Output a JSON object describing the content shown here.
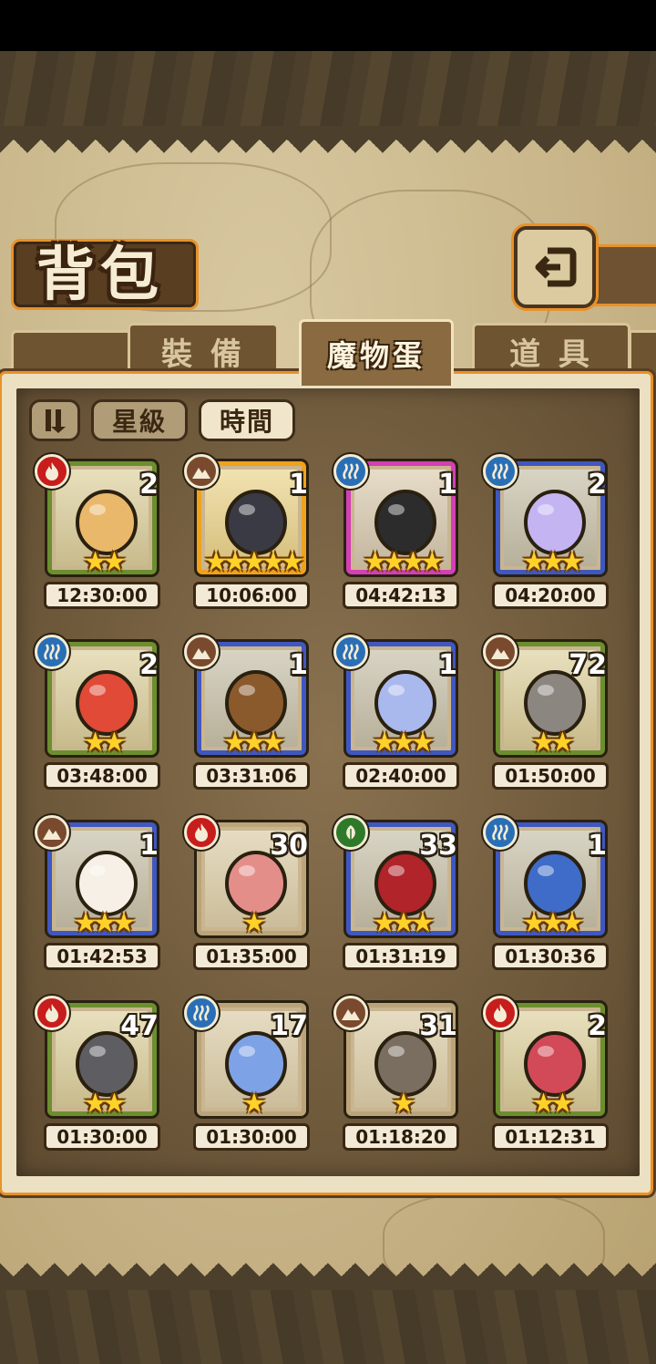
{
  "title": "背包",
  "tabs": [
    {
      "label": "裝 備",
      "active": false
    },
    {
      "label": "魔物蛋",
      "active": true
    },
    {
      "label": "道 具",
      "active": false
    }
  ],
  "sort_buttons": [
    {
      "label": "星級",
      "active": false
    },
    {
      "label": "時間",
      "active": true
    }
  ],
  "colors": {
    "fire": "#c81d1d",
    "earth": "#7a4a2e",
    "water": "#2a6fb6",
    "wood": "#2e7a2a",
    "accent_orange": "#e8922a"
  },
  "eggs": [
    {
      "element": "fire",
      "rarity": "green",
      "count": "2",
      "stars": 2,
      "time": "12:30:00",
      "color": "#e9b86a"
    },
    {
      "element": "earth",
      "rarity": "gold",
      "count": "1",
      "stars": 5,
      "time": "10:06:00",
      "color": "#3a3a44"
    },
    {
      "element": "water",
      "rarity": "purple",
      "count": "1",
      "stars": 4,
      "time": "04:42:13",
      "color": "#2c2c2c"
    },
    {
      "element": "water",
      "rarity": "blue",
      "count": "2",
      "stars": 3,
      "time": "04:20:00",
      "color": "#c4b4f2"
    },
    {
      "element": "water",
      "rarity": "green",
      "count": "2",
      "stars": 2,
      "time": "03:48:00",
      "color": "#e04a36"
    },
    {
      "element": "earth",
      "rarity": "blue",
      "count": "1",
      "stars": 3,
      "time": "03:31:06",
      "color": "#8a5a2c"
    },
    {
      "element": "water",
      "rarity": "blue",
      "count": "1",
      "stars": 3,
      "time": "02:40:00",
      "color": "#a9b9ee"
    },
    {
      "element": "earth",
      "rarity": "green",
      "count": "72",
      "stars": 2,
      "time": "01:50:00",
      "color": "#8c8680"
    },
    {
      "element": "earth",
      "rarity": "blue",
      "count": "1",
      "stars": 3,
      "time": "01:42:53",
      "color": "#f6f0e6"
    },
    {
      "element": "fire",
      "rarity": "plain",
      "count": "30",
      "stars": 1,
      "time": "01:35:00",
      "color": "#e48e8a"
    },
    {
      "element": "wood",
      "rarity": "blue",
      "count": "33",
      "stars": 3,
      "time": "01:31:19",
      "color": "#b0242a"
    },
    {
      "element": "water",
      "rarity": "blue",
      "count": "1",
      "stars": 3,
      "time": "01:30:36",
      "color": "#3e6cc8"
    },
    {
      "element": "fire",
      "rarity": "green",
      "count": "47",
      "stars": 2,
      "time": "01:30:00",
      "color": "#5e5e62"
    },
    {
      "element": "water",
      "rarity": "plain",
      "count": "17",
      "stars": 1,
      "time": "01:30:00",
      "color": "#7ea2e6"
    },
    {
      "element": "earth",
      "rarity": "plain",
      "count": "31",
      "stars": 1,
      "time": "01:18:20",
      "color": "#7a6e60"
    },
    {
      "element": "fire",
      "rarity": "green",
      "count": "2",
      "stars": 2,
      "time": "01:12:31",
      "color": "#d24a58"
    }
  ]
}
